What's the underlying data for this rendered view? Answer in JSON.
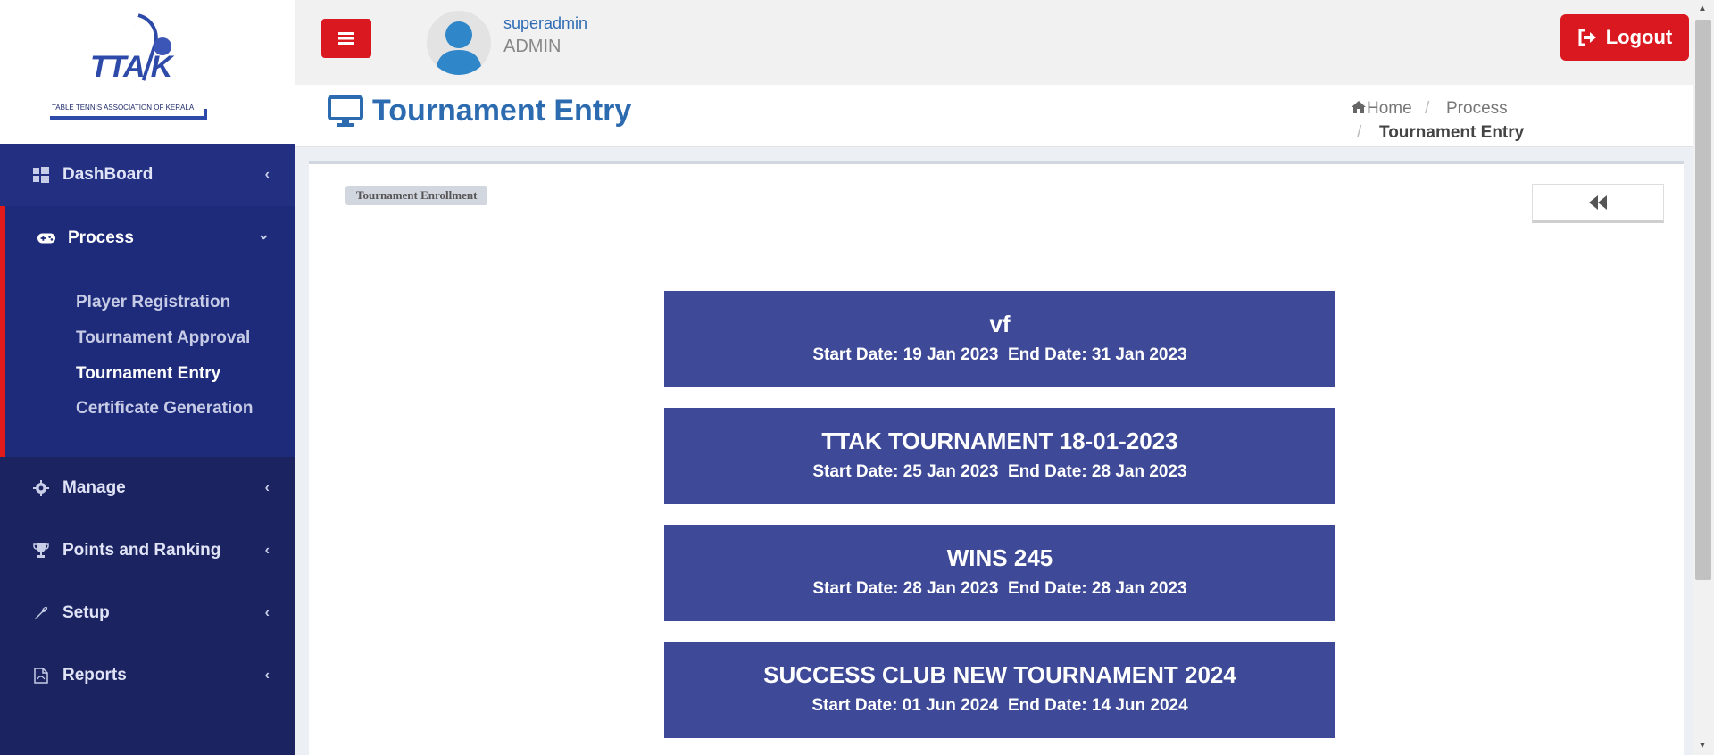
{
  "logo": {
    "text": "TTA K",
    "tagline": "TABLE TENNIS ASSOCIATION OF KERALA"
  },
  "sidebar": {
    "items": [
      {
        "label": "DashBoard",
        "icon": "windows-icon"
      },
      {
        "label": "Process",
        "icon": "gamepad-icon",
        "expanded": true,
        "children": [
          "Player Registration",
          "Tournament Approval",
          "Tournament Entry",
          "Certificate Generation"
        ],
        "active_child": "Tournament Entry"
      },
      {
        "label": "Manage",
        "icon": "gear-icon"
      },
      {
        "label": "Points and Ranking",
        "icon": "trophy-icon"
      },
      {
        "label": "Setup",
        "icon": "wrench-icon"
      },
      {
        "label": "Reports",
        "icon": "file-pdf-icon"
      }
    ]
  },
  "topbar": {
    "username": "superadmin",
    "role": "ADMIN",
    "logout_label": "Logout"
  },
  "header": {
    "title": "Tournament Entry",
    "breadcrumb": [
      "Home",
      "Process",
      "Tournament Entry"
    ]
  },
  "content": {
    "section_label": "Tournament Enrollment",
    "tournaments": [
      {
        "name": "vf",
        "dates": "Start Date: 19 Jan 2023  End Date: 31 Jan 2023"
      },
      {
        "name": "TTAK TOURNAMENT 18-01-2023",
        "dates": "Start Date: 25 Jan 2023  End Date: 28 Jan 2023"
      },
      {
        "name": "WINS 245",
        "dates": "Start Date: 28 Jan 2023  End Date: 28 Jan 2023"
      },
      {
        "name": "SUCCESS CLUB NEW TOURNAMENT 2024",
        "dates": "Start Date: 01 Jun 2024  End Date: 14 Jun 2024"
      }
    ]
  },
  "colors": {
    "sidebar": "#1b2361",
    "accent_red": "#d9181f",
    "card": "#3e4a97",
    "title_blue": "#2d6bb0"
  }
}
